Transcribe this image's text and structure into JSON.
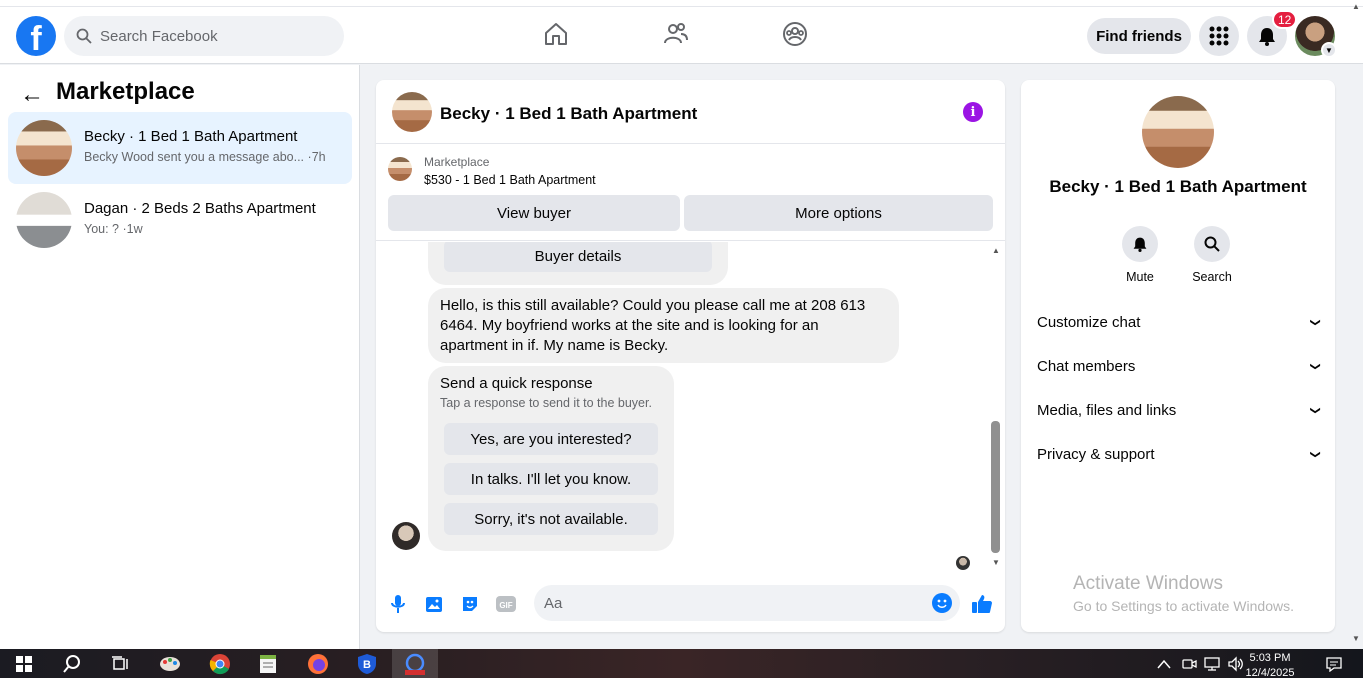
{
  "topbar": {
    "logo_letter": "f",
    "search_placeholder": "Search Facebook",
    "find_friends": "Find friends",
    "notification_count": "12"
  },
  "left": {
    "title": "Marketplace",
    "conversations": [
      {
        "title": "Becky · 1 Bed 1 Bath Apartment",
        "snippet": "Becky Wood sent you a message abo...",
        "time": "·7h"
      },
      {
        "title": "Dagan · 2 Beds 2 Baths Apartment",
        "snippet": "You: ? ·1w",
        "time": ""
      }
    ]
  },
  "chat": {
    "title": "Becky · 1 Bed 1 Bath Apartment",
    "marketplace_label": "Marketplace",
    "item": "$530 - 1 Bed 1 Bath Apartment",
    "view_buyer": "View buyer",
    "more_options": "More options",
    "buyer_details": "Buyer details",
    "message_lines": [
      "Hello, is this still available? Could you please call me at 208 613",
      "6464. My boyfriend works at the site and is looking for an",
      "apartment in if. My name is Becky."
    ],
    "quick_title": "Send a quick response",
    "quick_sub": "Tap a response to send it to the buyer.",
    "quick_replies": [
      "Yes, are you interested?",
      "In talks. I'll let you know.",
      "Sorry, it's not available."
    ],
    "composer_placeholder": "Aa"
  },
  "right": {
    "title": "Becky · 1 Bed 1 Bath Apartment",
    "mute": "Mute",
    "search": "Search",
    "sections": [
      "Customize chat",
      "Chat members",
      "Media, files and links",
      "Privacy & support"
    ]
  },
  "watermark": {
    "line1": "Activate Windows",
    "line2": "Go to Settings to activate Windows."
  },
  "taskbar": {
    "time": "5:03 PM",
    "date": "12/4/2025"
  },
  "colors": {
    "brand": "#1877f2",
    "badge": "#e41e3f",
    "info": "#9b14e4",
    "active_row": "#e7f3ff"
  }
}
